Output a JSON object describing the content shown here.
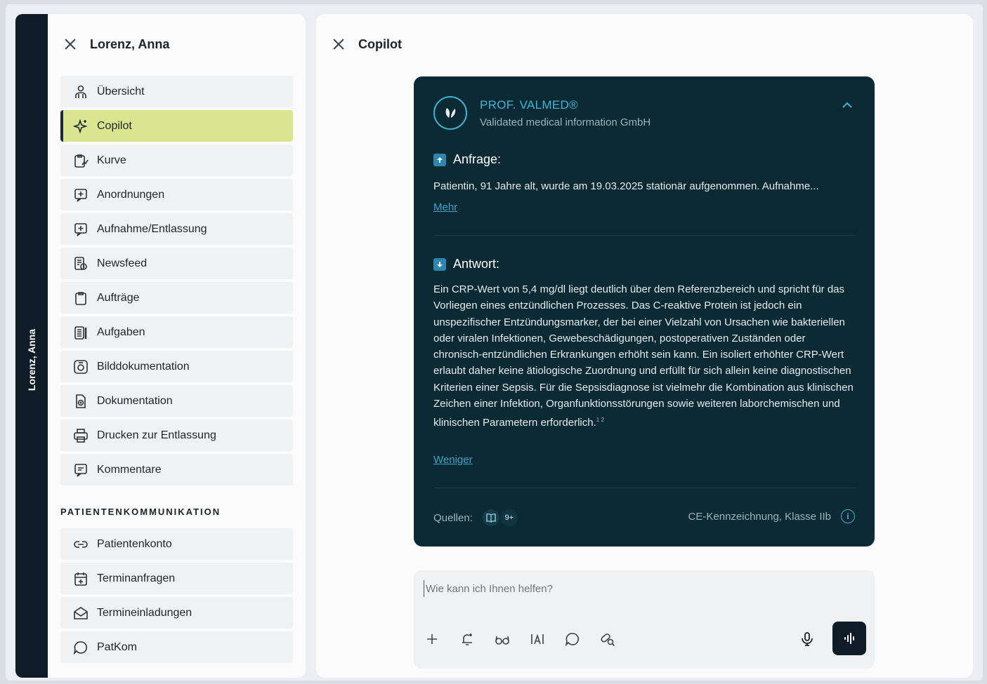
{
  "patient_strip": {
    "label": "Lorenz, Anna"
  },
  "left_panel": {
    "title": "Lorenz, Anna",
    "items": [
      {
        "label": "Übersicht",
        "icon": "person-icon"
      },
      {
        "label": "Copilot",
        "icon": "sparkle-icon",
        "active": true
      },
      {
        "label": "Kurve",
        "icon": "chart-clipboard-icon"
      },
      {
        "label": "Anordnungen",
        "icon": "plus-message-icon"
      },
      {
        "label": "Aufnahme/Entlassung",
        "icon": "plus-message-icon"
      },
      {
        "label": "Newsfeed",
        "icon": "newsfeed-icon"
      },
      {
        "label": "Aufträge",
        "icon": "clipboard-icon"
      },
      {
        "label": "Aufgaben",
        "icon": "tasks-icon"
      },
      {
        "label": "Bilddokumentation",
        "icon": "camera-icon"
      },
      {
        "label": "Dokumentation",
        "icon": "document-icon"
      },
      {
        "label": "Drucken zur Entlassung",
        "icon": "printer-icon"
      },
      {
        "label": "Kommentare",
        "icon": "comment-icon"
      }
    ],
    "section_heading": "PATIENTENKOMMUNIKATION",
    "comm_items": [
      {
        "label": "Patientenkonto",
        "icon": "link-icon"
      },
      {
        "label": "Terminanfragen",
        "icon": "calendar-icon"
      },
      {
        "label": "Termineinladungen",
        "icon": "envelope-icon"
      },
      {
        "label": "PatKom",
        "icon": "chat-icon"
      }
    ]
  },
  "right_panel": {
    "title": "Copilot",
    "card": {
      "brand_name": "PROF. VALMED®",
      "brand_sub": "Validated medical information GmbH",
      "query_heading": "Anfrage:",
      "query_text": "Patientin, 91 Jahre alt, wurde am 19.03.2025 stationär aufgenommen. Aufnahme...",
      "more_link": "Mehr",
      "answer_heading": "Antwort:",
      "answer_text": "Ein CRP-Wert von 5,4 mg/dl liegt deutlich über dem Referenzbereich und spricht für das Vorliegen eines entzündlichen Prozesses. Das C-reaktive Protein ist jedoch ein unspezifischer Entzündungsmarker, der bei einer Vielzahl von Ursachen wie bakteriellen oder viralen Infektionen, Gewebeschädigungen, postoperativen Zuständen oder chronisch-entzündlichen Erkrankungen erhöht sein kann. Ein isoliert erhöhter CRP-Wert erlaubt daher keine ätiologische Zuordnung und erfüllt für sich allein keine diagnostischen Kriterien einer Sepsis. Für die Sepsisdiagnose ist vielmehr die Kombination aus klinischen Zeichen einer Infektion, Organfunktionsstörungen sowie weiteren laborchemischen und klinischen Parametern erforderlich.",
      "answer_sup": "1 2",
      "less_link": "Weniger",
      "sources_label": "Quellen:",
      "sources_count": "9+",
      "ce_label": "CE-Kennzeichnung, Klasse IIb",
      "info_glyph": "i"
    },
    "input": {
      "placeholder": "Wie kann ich Ihnen helfen?"
    },
    "tools": [
      "plus-icon",
      "bell-sparkle-icon",
      "glasses-icon",
      "text-format-icon",
      "chat-bubble-icon",
      "pill-search-icon"
    ],
    "colors": {
      "accent": "#d9e58f",
      "card": "#0b2a34",
      "brand": "#3db4d6"
    }
  }
}
